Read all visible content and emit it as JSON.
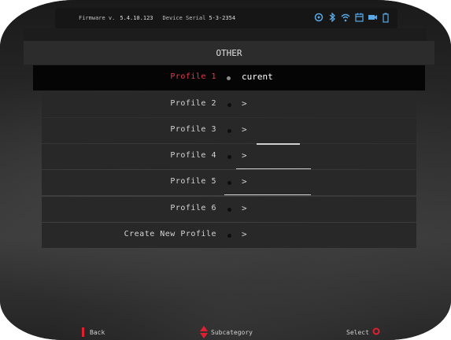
{
  "statusbar": {
    "firmware_label": "Firmware v.",
    "firmware_version": "5.4.10.123",
    "serial_label": "Device Serial",
    "serial_value": "5-3-2354",
    "icons": [
      "gps-icon",
      "bluetooth-icon",
      "wifi-icon",
      "calendar-icon",
      "video-icon",
      "battery-icon"
    ]
  },
  "menu": {
    "title": "OTHER",
    "items": [
      {
        "label": "Profile 1",
        "value": "curent",
        "selected": true
      },
      {
        "label": "Profile 2",
        "value": ">",
        "selected": false
      },
      {
        "label": "Profile 3",
        "value": ">",
        "selected": false
      },
      {
        "label": "Profile 4",
        "value": ">",
        "selected": false
      },
      {
        "label": "Profile 5",
        "value": ">",
        "selected": false
      },
      {
        "label": "Profile 6",
        "value": ">",
        "selected": false
      },
      {
        "label": "Create New Profile",
        "value": ">",
        "selected": false
      }
    ]
  },
  "footer": {
    "back_label": "Back",
    "subcategory_label": "Subcategory",
    "select_label": "Select"
  },
  "colors": {
    "accent_red": "#e02030",
    "selected_text": "#e63a4a",
    "icon_blue": "#5aa9e6"
  }
}
